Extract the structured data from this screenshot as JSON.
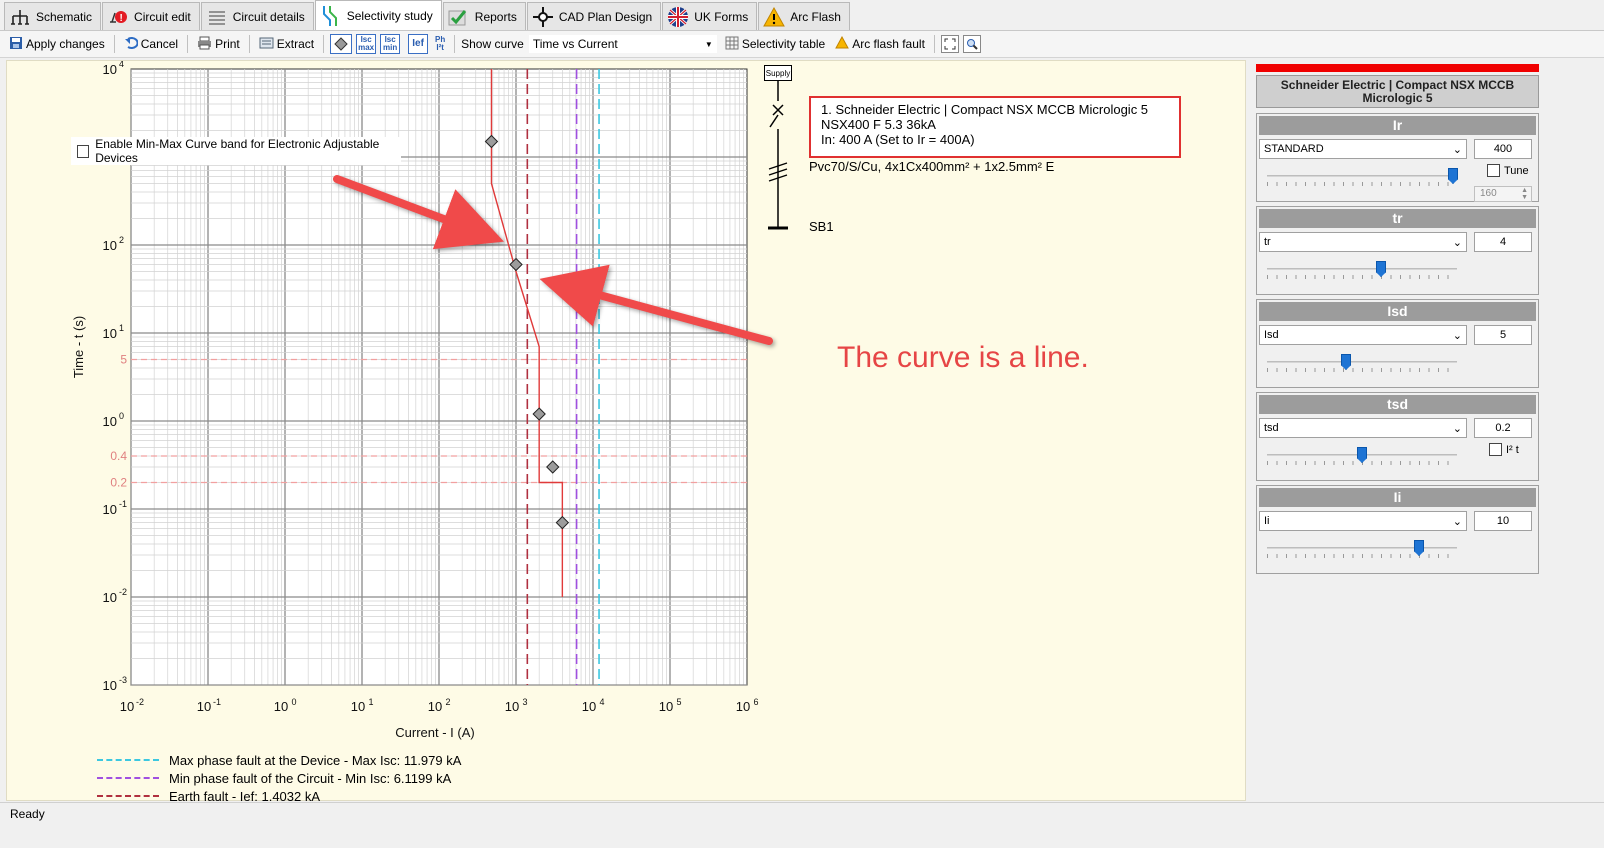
{
  "tabs": [
    {
      "label": "Schematic",
      "icon": "schematic-icon"
    },
    {
      "label": "Circuit edit",
      "icon": "circuit-edit-icon"
    },
    {
      "label": "Circuit details",
      "icon": "list-icon"
    },
    {
      "label": "Selectivity study",
      "icon": "selectivity-icon",
      "active": true
    },
    {
      "label": "Reports",
      "icon": "check-icon"
    },
    {
      "label": "CAD Plan Design",
      "icon": "crosshair-icon"
    },
    {
      "label": "UK Forms",
      "icon": "uk-flag-icon"
    },
    {
      "label": "Arc Flash",
      "icon": "warning-icon"
    }
  ],
  "toolbar": {
    "apply": "Apply changes",
    "cancel": "Cancel",
    "print": "Print",
    "extract": "Extract",
    "isc_max": "Isc max",
    "isc_min": "Isc min",
    "ief": "Ief",
    "ph": "Ph I²t",
    "show_curve": "Show curve",
    "curve_value": "Time vs Current",
    "selectivity_table": "Selectivity table",
    "arc_flash_fault": "Arc flash fault"
  },
  "enable_minmax": "Enable Min-Max Curve band for Electronic Adjustable Devices",
  "chart_data": {
    "type": "line",
    "xlabel": "Current - I (A)",
    "ylabel": "Time - t (s)",
    "x_scale": "log",
    "y_scale": "log",
    "xlim": [
      0.01,
      1000000
    ],
    "ylim": [
      0.001,
      10000
    ],
    "x_ticks": [
      {
        "b": "10",
        "e": "-2"
      },
      {
        "b": "10",
        "e": "-1"
      },
      {
        "b": "10",
        "e": "0"
      },
      {
        "b": "10",
        "e": "1"
      },
      {
        "b": "10",
        "e": "2"
      },
      {
        "b": "10",
        "e": "3"
      },
      {
        "b": "10",
        "e": "4"
      },
      {
        "b": "10",
        "e": "5"
      },
      {
        "b": "10",
        "e": "6"
      }
    ],
    "y_ticks": [
      {
        "b": "10",
        "e": "4"
      },
      {
        "b": "10",
        "e": "2"
      },
      {
        "b": "10",
        "e": "1"
      },
      {
        "b": "10",
        "e": "0"
      },
      {
        "b": "10",
        "e": "-1"
      },
      {
        "b": "10",
        "e": "-2"
      },
      {
        "b": "10",
        "e": "-3"
      }
    ],
    "y_ref_lines": [
      {
        "value": 5,
        "label": "5"
      },
      {
        "value": 0.4,
        "label": "0.4"
      },
      {
        "value": 0.2,
        "label": "0.2"
      }
    ],
    "series": [
      {
        "color": "#e03a3a",
        "points": [
          [
            480,
            10000
          ],
          [
            480,
            500
          ],
          [
            1000,
            50
          ],
          [
            2000,
            7
          ],
          [
            2000,
            0.2
          ],
          [
            4000,
            0.2
          ],
          [
            4000,
            0.01
          ]
        ]
      }
    ],
    "markers": [
      [
        480,
        1500
      ],
      [
        1000,
        60
      ],
      [
        2000,
        1.2
      ],
      [
        3000,
        0.3
      ],
      [
        4000,
        0.07
      ]
    ],
    "fault_lines": [
      {
        "value": 11979,
        "color": "#3cc8e0"
      },
      {
        "value": 6120,
        "color": "#a050e0"
      },
      {
        "value": 1403,
        "color": "#b03040"
      }
    ],
    "legend": [
      {
        "label": "Max phase fault at the Device - Max Isc: 11.979 kA",
        "color": "#3cc8e0"
      },
      {
        "label": "Min phase fault of the Circuit - Min Isc: 6.1199 kA",
        "color": "#a050e0"
      },
      {
        "label": "Earth fault - Ief: 1.4032 kA",
        "color": "#b03040"
      }
    ]
  },
  "diagram": {
    "supply": "Supply",
    "device_lines": [
      "1. Schneider Electric | Compact NSX MCCB Micrologic 5",
      "NSX400 F 5.3 36kA",
      "In: 400 A (Set to Ir = 400A)"
    ],
    "cable": "Pvc70/S/Cu, 4x1Cx400mm² + 1x2.5mm² E",
    "board": "SB1"
  },
  "annotation": "The curve is a line.",
  "panel": {
    "title": "Schneider Electric | Compact NSX MCCB Micrologic 5",
    "settings": [
      {
        "name": "Ir",
        "dropdown": "STANDARD",
        "value": "400",
        "slider": 1.0,
        "tune_label": "Tune",
        "spin": "160"
      },
      {
        "name": "tr",
        "dropdown": "tr",
        "value": "4",
        "slider": 0.6
      },
      {
        "name": "Isd",
        "dropdown": "Isd",
        "value": "5",
        "slider": 0.42
      },
      {
        "name": "tsd",
        "dropdown": "tsd",
        "value": "0.2",
        "slider": 0.5,
        "i2t_label": "I² t"
      },
      {
        "name": "Ii",
        "dropdown": "Ii",
        "value": "10",
        "slider": 0.8
      }
    ]
  },
  "status": "Ready"
}
